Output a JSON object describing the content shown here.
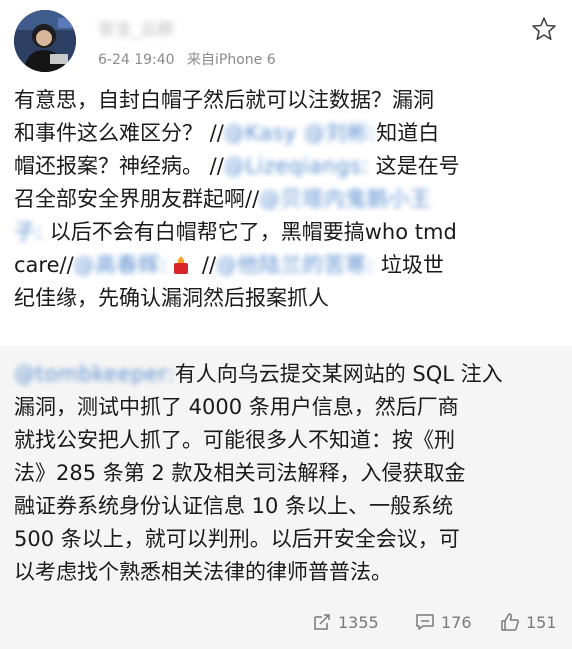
{
  "user": {
    "name": "安全_云胖",
    "date": "6-24 19:40",
    "source": "来自iPhone 6"
  },
  "post": {
    "l1": "有意思，自封白帽子然后就可以注数据？漏洞",
    "l2_a": "和事件这么难区分？",
    "l2_slash": " //",
    "l2_mention": "@Kasy @刘彬:",
    "l2_b": "知道白",
    "l3_a": "帽还报案？神经病。",
    "l3_slash": " //",
    "l3_mention": "@Lizeqiangs:",
    "l3_b": " 这是在号",
    "l4_a": "召全部安全界朋友群起啊//",
    "l4_mention": "@贝塔内鬼鹅小王",
    "l5_mention": "子:",
    "l5_b": " 以后不会有白帽帮它了，黑帽要搞who tmd",
    "l6_a": "care//",
    "l6_mention1": "@高春辉:",
    "l6_slash": " //",
    "l6_mention2": "@他陆兰的苦寒:",
    "l6_b": " 垃圾世",
    "l7": "纪佳缘，先确认漏洞然后报案抓人"
  },
  "repost": {
    "l1_mention": "@tombkeeper:",
    "l1_b": "有人向乌云提交某网站的 SQL 注入",
    "l2": "漏洞，测试中抓了 4000 条用户信息，然后厂商",
    "l3": "就找公安把人抓了。可能很多人不知道：按《刑",
    "l4": "法》285 条第 2 款及相关司法解释，入侵获取金",
    "l5": "融证券系统身份认证信息 10 条以上、一般系统",
    "l6": "500 条以上，就可以判刑。以后开安全会议，可",
    "l7": "以考虑找个熟悉相关法律的律师普普法。"
  },
  "actions": {
    "reposts": "1355",
    "comments": "176",
    "likes": "151"
  },
  "icons": {
    "star": "star-icon",
    "repost": "repost-icon",
    "comment": "comment-icon",
    "like": "thumbs-up-icon",
    "fire": "fire-emoji-icon"
  },
  "colors": {
    "link": "#5b8fd0",
    "meta": "#8b8b8b",
    "repost_bg": "#f5f5f5"
  }
}
